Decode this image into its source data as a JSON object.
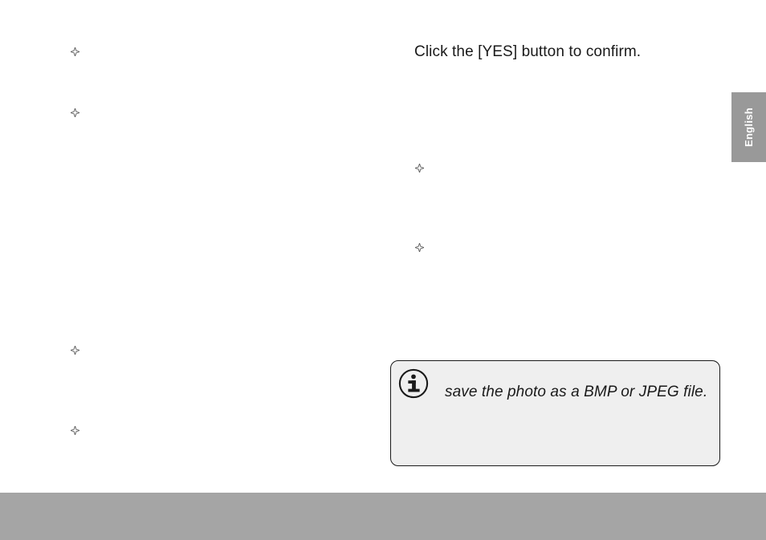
{
  "main_text": "Click the [YES] button to confirm.",
  "info_box": {
    "text": "save the photo as a BMP or JPEG file."
  },
  "language_tab": "English"
}
